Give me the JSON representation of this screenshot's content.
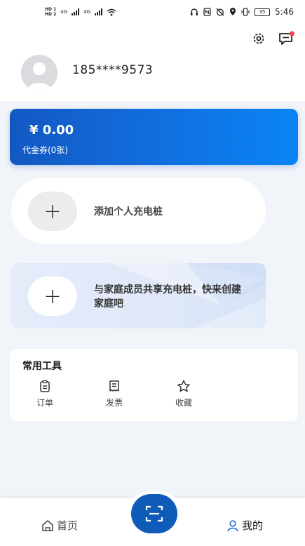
{
  "status_bar": {
    "network_1": "4G",
    "network_2": "4G",
    "battery": "35",
    "time": "5:46"
  },
  "header": {
    "phone": "185****9573",
    "settings_icon": "gear-icon",
    "message_icon": "message-icon"
  },
  "balance": {
    "amount": "¥ 0.00",
    "voucher": "代金券(0张)"
  },
  "add_personal": {
    "label": "添加个人充电桩"
  },
  "family": {
    "label": "与家庭成员共享充电桩，快来创建家庭吧"
  },
  "tools": {
    "title": "常用工具",
    "items": [
      {
        "label": "订单",
        "icon": "clipboard-icon"
      },
      {
        "label": "发票",
        "icon": "receipt-icon"
      },
      {
        "label": "收藏",
        "icon": "star-icon"
      }
    ]
  },
  "nav": {
    "home": "首页",
    "mine": "我的",
    "accent": "#1f6fd6"
  }
}
